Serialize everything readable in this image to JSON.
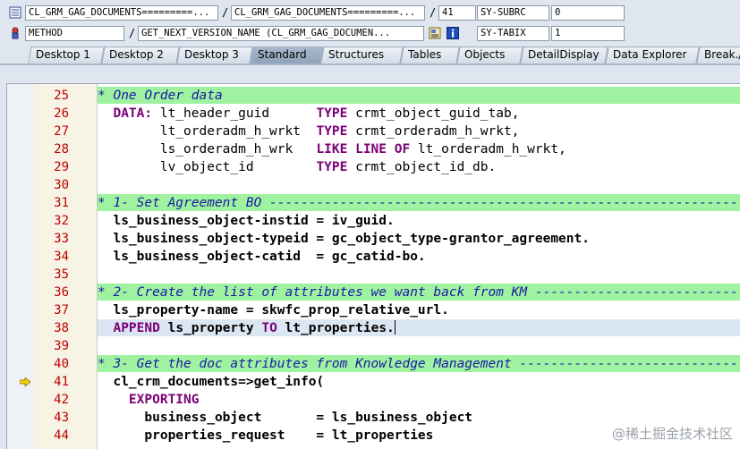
{
  "info": {
    "program": "CL_GRM_GAG_DOCUMENTS=========...",
    "include": "CL_GRM_GAG_DOCUMENTS=========...",
    "line": "41",
    "var1_name": "SY-SUBRC",
    "var1_value": "0",
    "event_type": "METHOD",
    "event_name": "GET_NEXT_VERSION_NAME (CL_GRM_GAG_DOCUMEN...",
    "var2_name": "SY-TABIX",
    "var2_value": "1"
  },
  "tabs": [
    {
      "label": "Desktop 1",
      "active": false
    },
    {
      "label": "Desktop 2",
      "active": false
    },
    {
      "label": "Desktop 3",
      "active": false
    },
    {
      "label": "Standard",
      "active": true
    },
    {
      "label": "Structures",
      "active": false
    },
    {
      "label": "Tables",
      "active": false
    },
    {
      "label": "Objects",
      "active": false
    },
    {
      "label": "DetailDisplay",
      "active": false
    },
    {
      "label": "Data Explorer",
      "active": false
    },
    {
      "label": "Break./",
      "active": false
    }
  ],
  "code_lines": [
    {
      "n": "25",
      "kind": "comment",
      "text": "* One Order data"
    },
    {
      "n": "26",
      "kind": "code",
      "parts": [
        [
          "  ",
          ""
        ],
        [
          "DATA:",
          "kw"
        ],
        [
          " lt_header_guid      ",
          ""
        ],
        [
          "TYPE",
          "kw"
        ],
        [
          " crmt_object_guid_tab,",
          ""
        ]
      ]
    },
    {
      "n": "27",
      "kind": "code",
      "parts": [
        [
          "        lt_orderadm_h_wrkt  ",
          ""
        ],
        [
          "TYPE",
          "kw"
        ],
        [
          " crmt_orderadm_h_wrkt,",
          ""
        ]
      ]
    },
    {
      "n": "28",
      "kind": "code",
      "parts": [
        [
          "        ls_orderadm_h_wrk   ",
          ""
        ],
        [
          "LIKE LINE OF",
          "kw"
        ],
        [
          " lt_orderadm_h_wrkt,",
          ""
        ]
      ]
    },
    {
      "n": "29",
      "kind": "code",
      "parts": [
        [
          "        lv_object_id        ",
          ""
        ],
        [
          "TYPE",
          "kw"
        ],
        [
          " crmt_object_id_db.",
          ""
        ]
      ]
    },
    {
      "n": "30",
      "kind": "blank"
    },
    {
      "n": "31",
      "kind": "comment",
      "text": "* 1- Set Agreement BO --------------------------------------------------------------------"
    },
    {
      "n": "32",
      "kind": "code",
      "parts": [
        [
          "  ls_business_object-instid = iv_guid.",
          "bo"
        ]
      ]
    },
    {
      "n": "33",
      "kind": "code",
      "parts": [
        [
          "  ls_business_object-typeid = gc_object_type-grantor_agreement.",
          "bo"
        ]
      ]
    },
    {
      "n": "34",
      "kind": "code",
      "parts": [
        [
          "  ls_business_object-catid  = gc_catid-bo.",
          "bo"
        ]
      ]
    },
    {
      "n": "35",
      "kind": "blank"
    },
    {
      "n": "36",
      "kind": "comment",
      "text": "* 2- Create the list of attributes we want back from KM -----------------------------"
    },
    {
      "n": "37",
      "kind": "code",
      "parts": [
        [
          "  ls_property-name = skwfc_prop_relative_url.",
          "bo"
        ]
      ]
    },
    {
      "n": "38",
      "kind": "cursor",
      "parts": [
        [
          "  ",
          ""
        ],
        [
          "APPEND",
          "kw"
        ],
        [
          " ls_property ",
          "bo"
        ],
        [
          "TO",
          "kw"
        ],
        [
          " lt_properties.",
          "bo"
        ]
      ]
    },
    {
      "n": "39",
      "kind": "blank"
    },
    {
      "n": "40",
      "kind": "comment",
      "text": "* 3- Get the doc attributes from Knowledge Management ------------------------------------"
    },
    {
      "n": "41",
      "kind": "code",
      "current": true,
      "parts": [
        [
          "  cl_crm_documents=>get_info(",
          "bo"
        ]
      ]
    },
    {
      "n": "42",
      "kind": "code",
      "parts": [
        [
          "    ",
          ""
        ],
        [
          "EXPORTING",
          "kw"
        ]
      ]
    },
    {
      "n": "43",
      "kind": "code",
      "parts": [
        [
          "      business_object       = ls_business_object",
          "bo"
        ]
      ]
    },
    {
      "n": "44",
      "kind": "code",
      "parts": [
        [
          "      properties_request    = lt_properties",
          "bo"
        ]
      ]
    }
  ],
  "watermark": "@稀土掘金技术社区"
}
